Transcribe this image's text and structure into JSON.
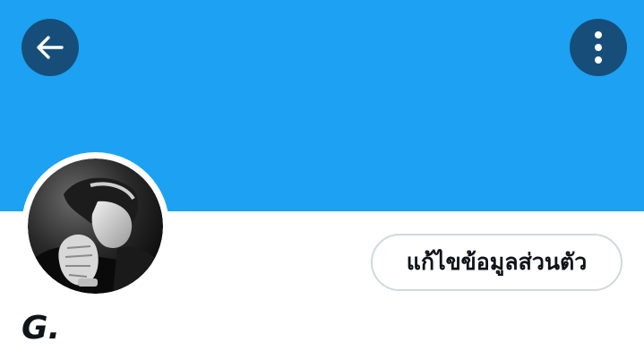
{
  "header": {
    "banner_color": "#1da1f2",
    "back_icon": "arrow-left-icon",
    "more_icon": "more-vertical-icon"
  },
  "profile": {
    "avatar_alt": "profile photo",
    "edit_button_label": "แก้ไขข้อมูลส่วนตัว",
    "display_name": "G."
  }
}
